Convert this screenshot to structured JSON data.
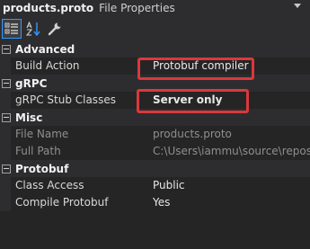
{
  "title": {
    "file": "products.proto",
    "type": "File Properties"
  },
  "toolbar": {
    "buttons": [
      {
        "icon": "categorized-icon",
        "active": true
      },
      {
        "icon": "alphabetical-sort-icon",
        "active": false
      },
      {
        "icon": "property-pages-wrench-icon",
        "active": false
      }
    ]
  },
  "categories": [
    {
      "name": "Advanced",
      "properties": [
        {
          "name": "Build Action",
          "value": "Protobuf compiler",
          "readonly": false,
          "bold": false
        }
      ]
    },
    {
      "name": "gRPC",
      "properties": [
        {
          "name": "gRPC Stub Classes",
          "value": "Server only",
          "readonly": false,
          "bold": true
        }
      ]
    },
    {
      "name": "Misc",
      "properties": [
        {
          "name": "File Name",
          "value": "products.proto",
          "readonly": true,
          "bold": false
        },
        {
          "name": "Full Path",
          "value": "C:\\Users\\iammu\\source\\repos\\g",
          "readonly": true,
          "bold": false
        }
      ]
    },
    {
      "name": "Protobuf",
      "properties": [
        {
          "name": "Class Access",
          "value": "Public",
          "readonly": false,
          "bold": false
        },
        {
          "name": "Compile Protobuf",
          "value": "Yes",
          "readonly": false,
          "bold": false
        }
      ]
    }
  ],
  "colors": {
    "background": "#252526",
    "header": "#2d2d30",
    "highlight": "#d9393c",
    "accent": "#3399ff"
  }
}
